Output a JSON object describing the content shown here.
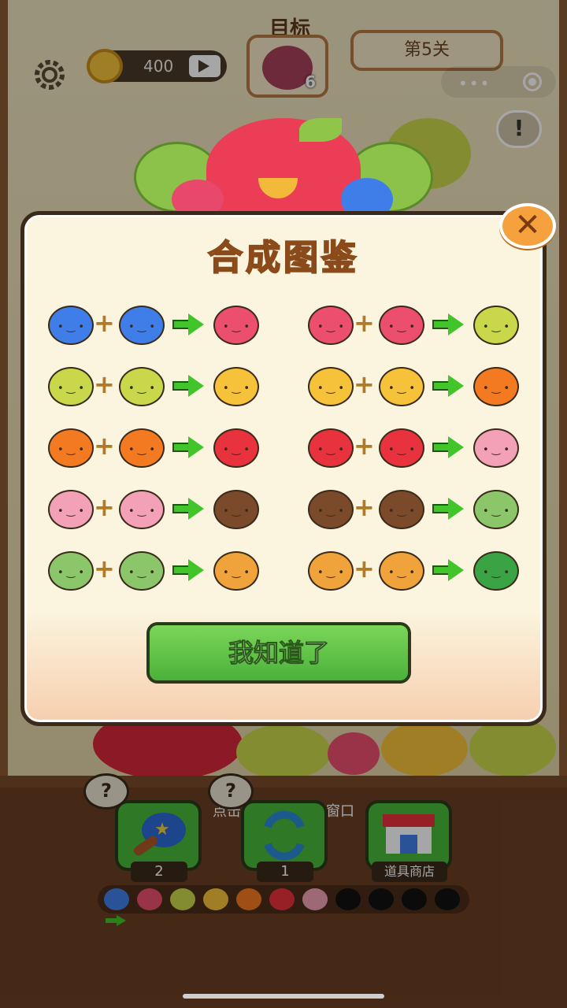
{
  "hud": {
    "coins": "400",
    "target_label": "目标",
    "target_count": "6",
    "level": "第5关",
    "info_symbol": "!",
    "more_symbol": "•••"
  },
  "modal": {
    "title": "合成图鉴",
    "close_symbol": "✕",
    "confirm_label": "我知道了",
    "recipes": [
      {
        "a": "blueberry",
        "b": "blueberry",
        "result": "raspberry"
      },
      {
        "a": "raspberry",
        "b": "raspberry",
        "result": "lemon"
      },
      {
        "a": "lemon",
        "b": "lemon",
        "result": "banana"
      },
      {
        "a": "banana",
        "b": "banana",
        "result": "orange"
      },
      {
        "a": "orange",
        "b": "orange",
        "result": "apple"
      },
      {
        "a": "apple",
        "b": "apple",
        "result": "peach"
      },
      {
        "a": "peach",
        "b": "peach",
        "result": "coconut"
      },
      {
        "a": "coconut",
        "b": "coconut",
        "result": "melon"
      },
      {
        "a": "melon",
        "b": "melon",
        "result": "cantaloupe"
      },
      {
        "a": "cantaloupe",
        "b": "cantaloupe",
        "result": "watermelon"
      }
    ],
    "plus_symbol": "+"
  },
  "colors": {
    "blueberry": "#3f7ee8",
    "raspberry": "#ec4f6e",
    "lemon": "#c9d84a",
    "banana": "#f5c23a",
    "orange": "#f47a22",
    "apple": "#e8323d",
    "peach": "#f3a1b6",
    "coconut": "#7a4a2a",
    "melon": "#8cc66a",
    "cantaloupe": "#f0a33a",
    "watermelon": "#3aa344"
  },
  "bottom": {
    "hint": "点击空白区域关闭窗口",
    "hammer_count": "2",
    "shuffle_count": "1",
    "shop_label": "道具商店",
    "question_symbol": "?"
  },
  "chain": [
    "blueberry",
    "raspberry",
    "lemon",
    "banana",
    "orange",
    "apple",
    "peach",
    "locked",
    "locked",
    "locked",
    "locked"
  ]
}
